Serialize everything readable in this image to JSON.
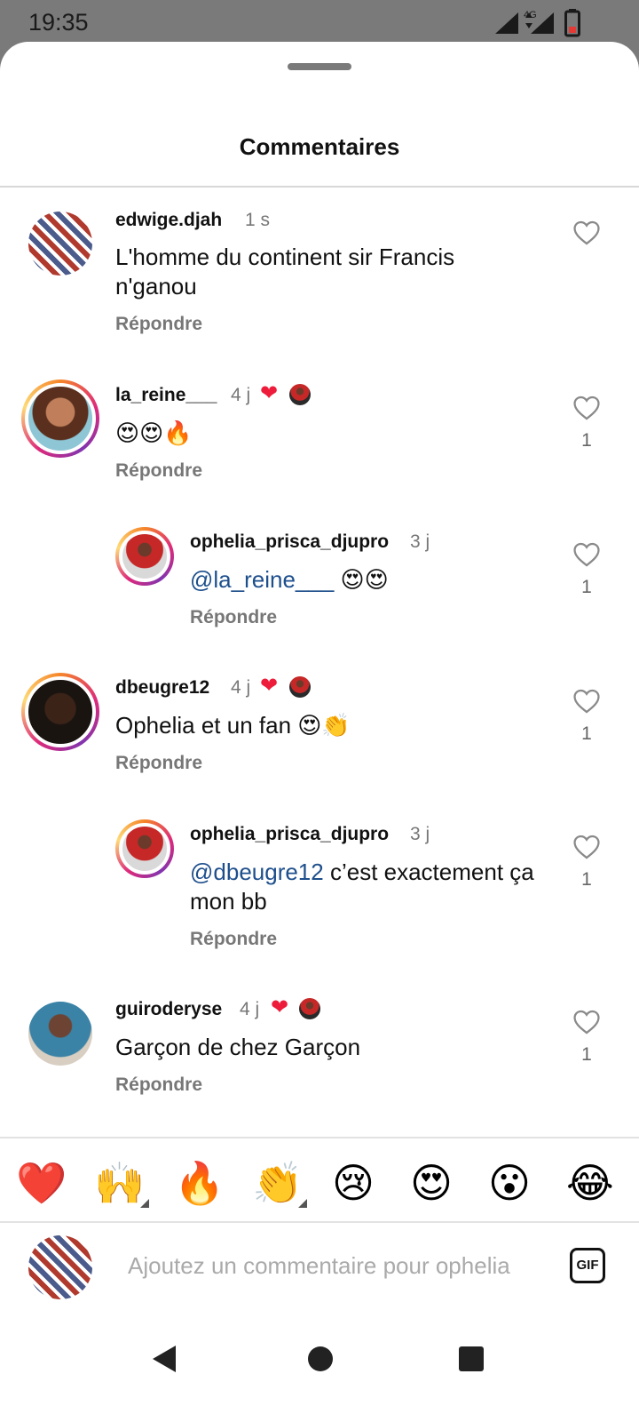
{
  "status_bar": {
    "time": "19:35",
    "network": "4G"
  },
  "sheet": {
    "title": "Commentaires"
  },
  "comments": [
    {
      "username": "edwige.djah",
      "time": "1 s",
      "text": "L'homme du continent sir Francis n'ganou",
      "reply": "Répondre",
      "likes": ""
    },
    {
      "username": "la_reine___",
      "time": "4 j",
      "text": "😍😍🔥",
      "reply": "Répondre",
      "likes": "1"
    },
    {
      "username": "ophelia_prisca_djupro",
      "time": "3 j",
      "mention": "@la_reine___",
      "text": " 😍😍",
      "reply": "Répondre",
      "likes": "1"
    },
    {
      "username": "dbeugre12",
      "time": "4 j",
      "text": "Ophelia et un fan 😍👏",
      "reply": "Répondre",
      "likes": "1"
    },
    {
      "username": "ophelia_prisca_djupro",
      "time": "3 j",
      "mention": "@dbeugre12",
      "text": "  c’est exactement ça mon bb",
      "reply": "Répondre",
      "likes": "1"
    },
    {
      "username": "guiroderyse",
      "time": "4 j",
      "text": "Garçon de chez Garçon",
      "reply": "Répondre",
      "likes": "1"
    }
  ],
  "quick_emojis": [
    "❤️",
    "🙌",
    "🔥",
    "👏",
    "😢",
    "😍",
    "😮",
    "😂"
  ],
  "composer": {
    "placeholder": "Ajoutez un commentaire pour ophelia",
    "gif_label": "GIF"
  },
  "icons": {
    "like": "heart-outline-icon",
    "creator_like": "heart-filled-icon",
    "nav_back": "triangle-back-icon",
    "nav_home": "circle-home-icon",
    "nav_recents": "square-recents-icon"
  },
  "colors": {
    "mention": "#1e4f8c",
    "heart": "#ed1c3a",
    "muted": "#777777"
  }
}
